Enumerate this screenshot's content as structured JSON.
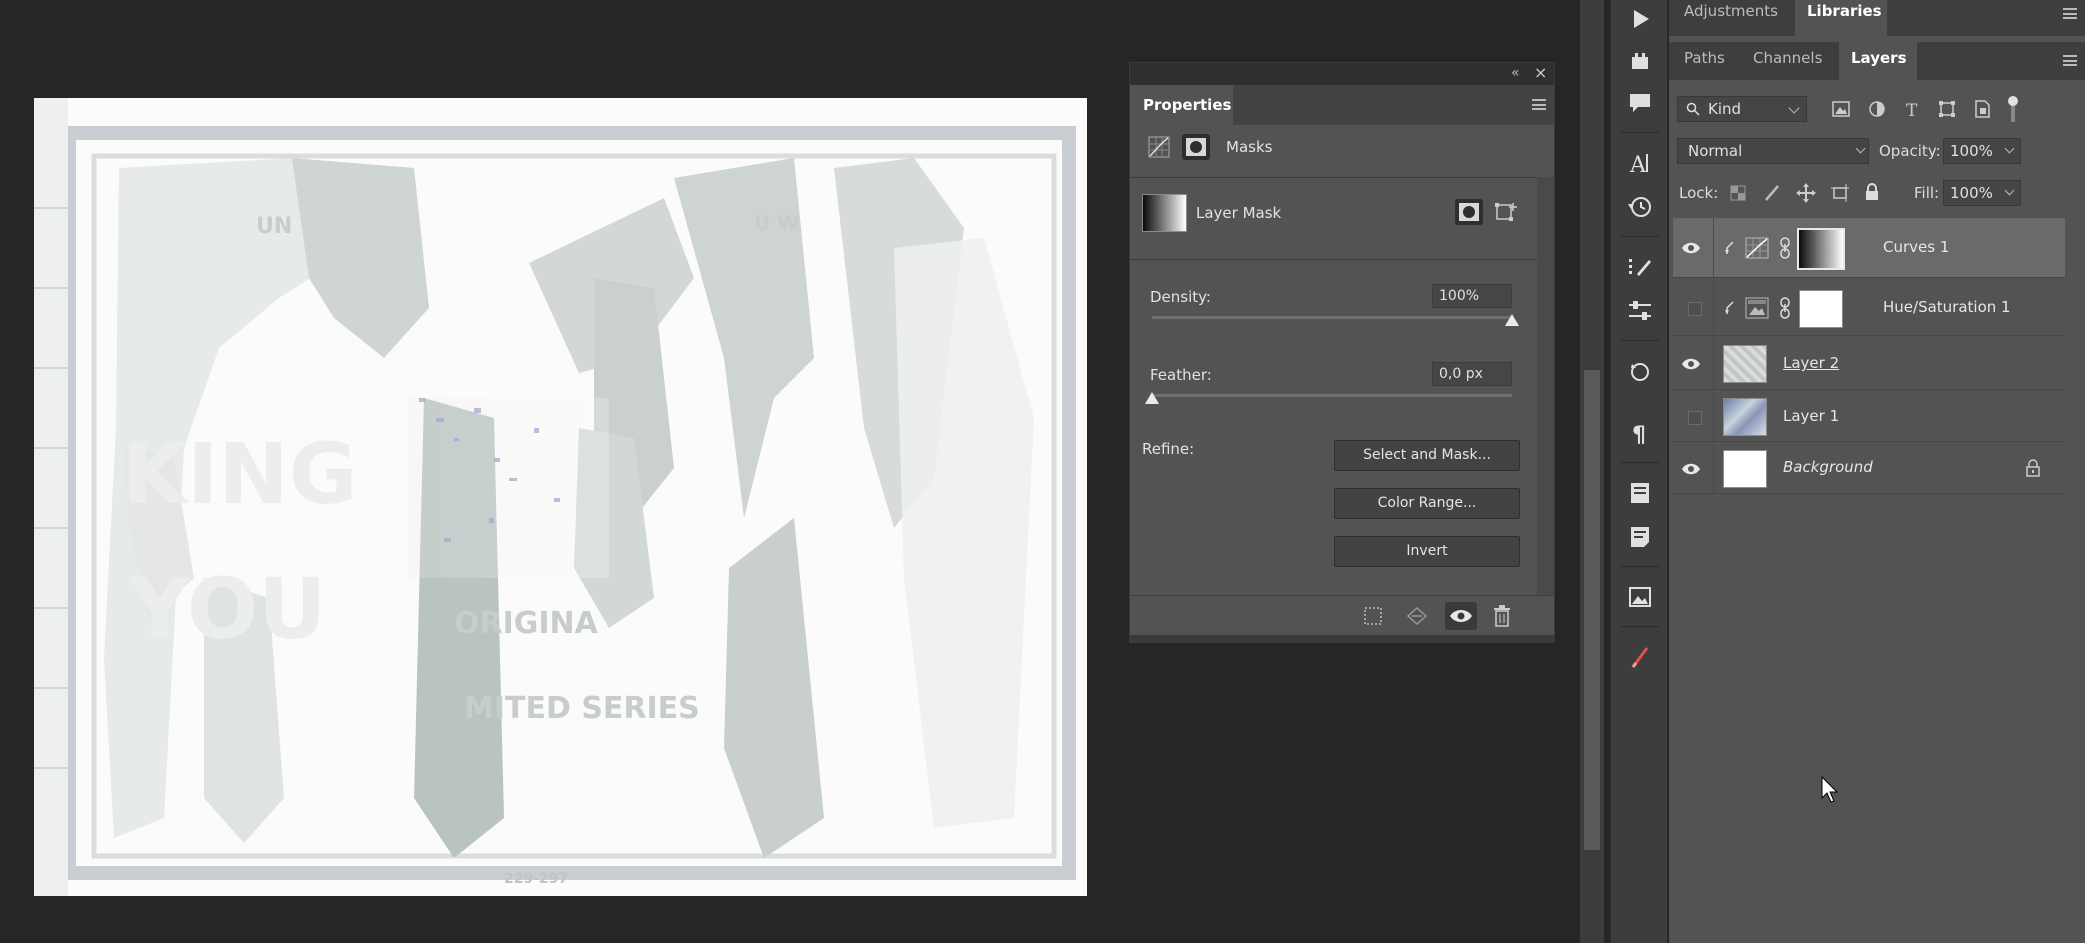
{
  "properties": {
    "title": "Properties",
    "section_label": "Masks",
    "layer_mask_label": "Layer Mask",
    "density": {
      "label": "Density:",
      "value": "100%",
      "level_percent": 100
    },
    "feather": {
      "label": "Feather:",
      "value": "0,0 px",
      "level_percent": 0
    },
    "refine_label": "Refine:",
    "buttons": {
      "select_and_mask": "Select and Mask...",
      "color_range": "Color Range...",
      "invert": "Invert"
    }
  },
  "right_panel": {
    "top_tabs": [
      "Adjustments",
      "Libraries"
    ],
    "active_top_tab": "Libraries",
    "layer_tabs": [
      "Paths",
      "Channels",
      "Layers"
    ],
    "active_layer_tab": "Layers",
    "filter_kind": "Kind",
    "blend_mode": "Normal",
    "opacity_label": "Opacity:",
    "opacity_value": "100%",
    "lock_label": "Lock:",
    "fill_label": "Fill:",
    "fill_value": "100%",
    "layers": [
      {
        "name": "Curves 1",
        "visible": true,
        "selected": true,
        "kind": "curves"
      },
      {
        "name": "Hue/Saturation 1",
        "visible": false,
        "selected": false,
        "kind": "huesat"
      },
      {
        "name": "Layer 2",
        "visible": true,
        "selected": false,
        "kind": "pixel"
      },
      {
        "name": "Layer 1",
        "visible": false,
        "selected": false,
        "kind": "pixel"
      },
      {
        "name": "Background",
        "visible": true,
        "selected": false,
        "kind": "background",
        "locked": true
      }
    ]
  },
  "canvas_text": [
    "UN",
    "U W",
    "KING",
    "YOU",
    "ORIGINA",
    "MITED SERIES",
    "229-297"
  ],
  "colors": {
    "app_bg": "#262626",
    "panel_bg": "#535353",
    "accent_brush": "#e0504a"
  }
}
